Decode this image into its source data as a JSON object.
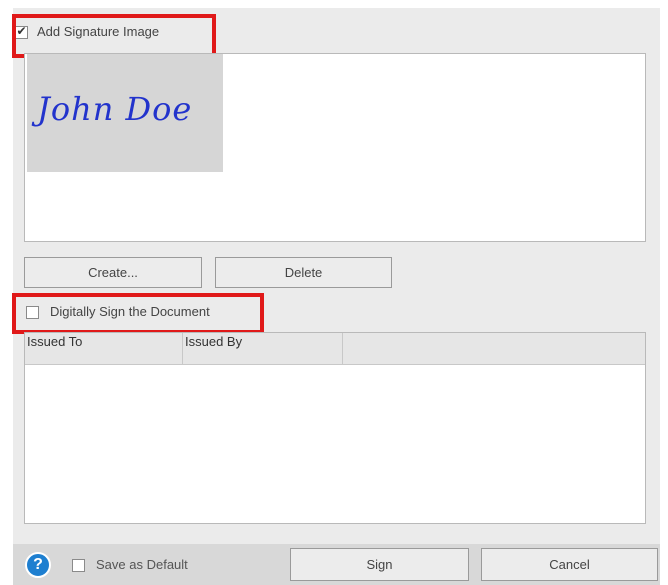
{
  "signature_image": {
    "checkbox_label": "Add Signature Image",
    "checked": true,
    "preview_text": "John Doe",
    "buttons": {
      "create": "Create...",
      "delete": "Delete"
    }
  },
  "digital_sign": {
    "checkbox_label": "Digitally Sign the Document",
    "checked": false,
    "columns": [
      "Issued To",
      "Issued By",
      ""
    ]
  },
  "footer": {
    "help_glyph": "?",
    "save_default_label": "Save as Default",
    "save_default_checked": false,
    "sign_label": "Sign",
    "cancel_label": "Cancel"
  },
  "colors": {
    "highlight": "#e01919",
    "help_icon": "#1e7fd0",
    "signature_ink": "#2233cc"
  }
}
